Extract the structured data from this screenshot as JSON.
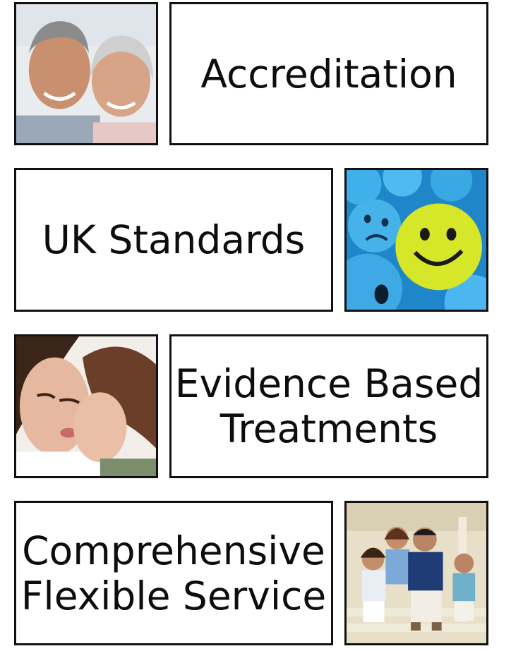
{
  "cards": [
    {
      "lines": [
        "Accreditation"
      ]
    },
    {
      "lines": [
        "UK Standards"
      ]
    },
    {
      "lines": [
        "Evidence Based",
        "Treatments"
      ]
    },
    {
      "lines": [
        "Comprehensive",
        "Flexible Service"
      ]
    }
  ],
  "photos": [
    {
      "name": "elderly-couple-photo"
    },
    {
      "name": "smiley-faces-photo"
    },
    {
      "name": "mother-child-kiss-photo"
    },
    {
      "name": "family-on-steps-photo"
    }
  ]
}
